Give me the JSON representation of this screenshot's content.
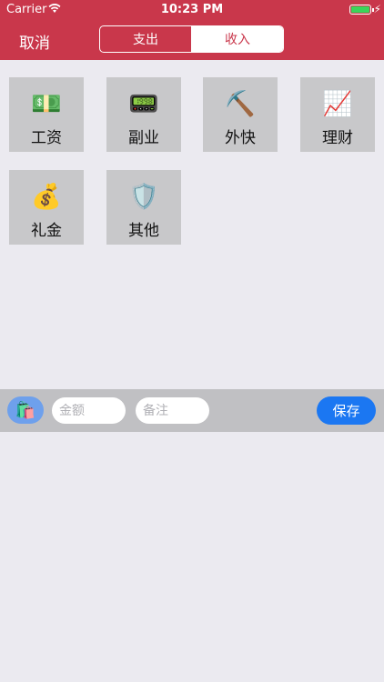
{
  "status_bar": {
    "carrier": "Carrier",
    "time": "10:23 PM"
  },
  "header": {
    "cancel_label": "取消",
    "tabs": [
      {
        "label": "支出",
        "selected": false
      },
      {
        "label": "收入",
        "selected": true
      }
    ],
    "accent_color": "#c9374b"
  },
  "categories": [
    {
      "label": "工资",
      "icon": "💵"
    },
    {
      "label": "副业",
      "icon": "📟"
    },
    {
      "label": "外快",
      "icon": "⛏️"
    },
    {
      "label": "理财",
      "icon": "📈"
    },
    {
      "label": "礼金",
      "icon": "💰"
    },
    {
      "label": "其他",
      "icon": "🛡️"
    }
  ],
  "input_bar": {
    "category_icon": "🛍️",
    "amount_placeholder": "金额",
    "note_placeholder": "备注",
    "save_label": "保存",
    "save_color": "#1b77f2"
  }
}
